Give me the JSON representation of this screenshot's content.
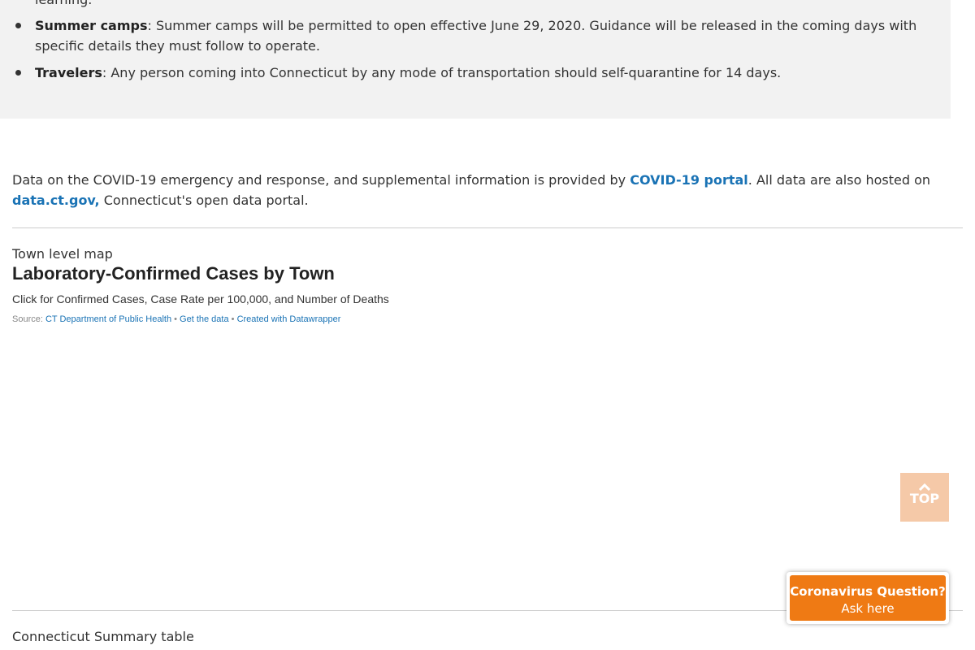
{
  "guidance": {
    "partial_text": "learning.",
    "items": [
      {
        "term": "Summer camps",
        "text": ": Summer camps will be permitted to open effective June 29, 2020. Guidance will be released in the coming days with specific details they must follow to operate."
      },
      {
        "term": "Travelers",
        "text": ": Any person coming into Connecticut by any mode of transportation should self-quarantine for 14 days."
      }
    ]
  },
  "intro": {
    "text_before": "Data on the COVID-19 emergency and response, and supplemental information is provided by ",
    "portal_link": "COVID-19 portal",
    "text_middle": ". All data are also hosted on ",
    "data_link": "data.ct.gov,",
    "text_after": " Connecticut's open data portal."
  },
  "map_section": {
    "label": "Town level map",
    "title": "Laboratory-Confirmed Cases by Town",
    "description": "Click for Confirmed Cases, Case Rate per 100,000, and Number of Deaths",
    "source_prefix": "Source: ",
    "source_link": "CT Department of Public Health",
    "bullet": "•",
    "get_data_link": "Get the data",
    "datawrapper_link": "Created with Datawrapper"
  },
  "summary_section": {
    "label": "Connecticut Summary table"
  },
  "top_button": {
    "label": "TOP",
    "icon": "chevron-up-icon"
  },
  "ask_widget": {
    "title": "Coronavirus Question?",
    "subtitle": "Ask here"
  },
  "colors": {
    "link": "#1a73b5",
    "ask_widget_bg": "#ef7a14",
    "top_button_bg": "#f5c9a8",
    "guidance_box_bg": "#f2f2f2"
  }
}
